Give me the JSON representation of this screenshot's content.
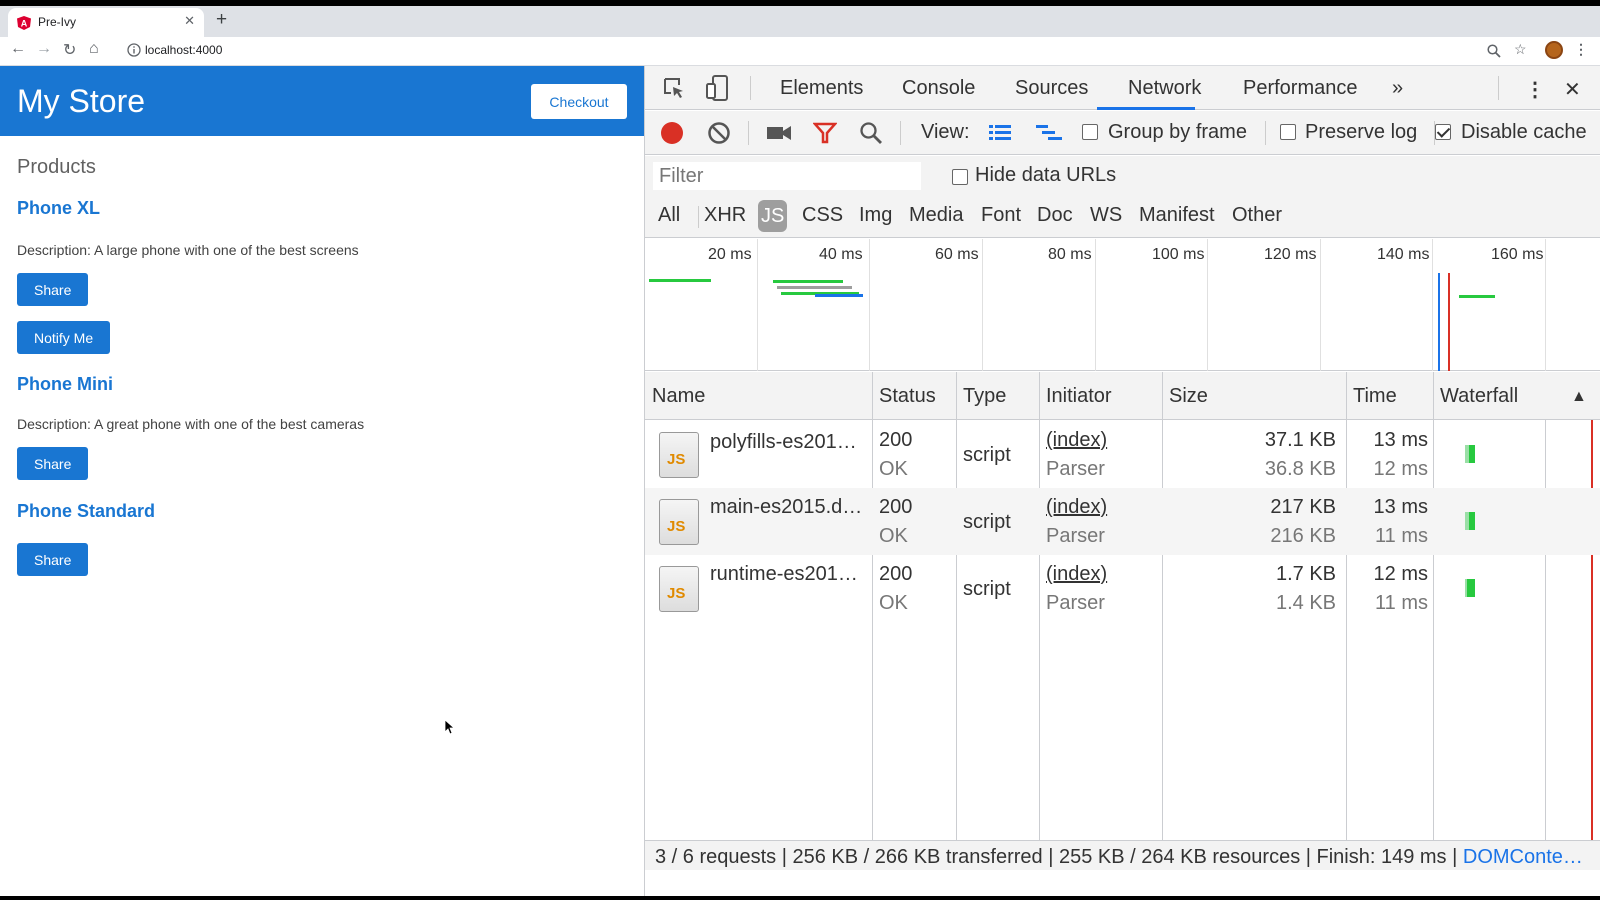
{
  "browser": {
    "tab_title": "Pre-Ivy",
    "url": "localhost:4000"
  },
  "app": {
    "title": "My Store",
    "checkout_label": "Checkout",
    "products_heading": "Products",
    "products": [
      {
        "name": "Phone XL",
        "description": "Description: A large phone with one of the best screens",
        "share_label": "Share",
        "notify_label": "Notify Me"
      },
      {
        "name": "Phone Mini",
        "description": "Description: A great phone with one of the best cameras",
        "share_label": "Share"
      },
      {
        "name": "Phone Standard",
        "share_label": "Share"
      }
    ]
  },
  "devtools": {
    "tabs": [
      "Elements",
      "Console",
      "Sources",
      "Network",
      "Performance"
    ],
    "active_tab": "Network",
    "more_tabs_glyph": "»",
    "toolbar": {
      "view_label": "View:",
      "group_by_frame_label": "Group by frame",
      "group_by_frame_checked": false,
      "preserve_log_label": "Preserve log",
      "preserve_log_checked": false,
      "disable_cache_label": "Disable cache",
      "disable_cache_checked": true
    },
    "filter": {
      "placeholder": "Filter",
      "hide_data_urls_label": "Hide data URLs",
      "hide_data_urls_checked": false,
      "types": [
        "All",
        "XHR",
        "JS",
        "CSS",
        "Img",
        "Media",
        "Font",
        "Doc",
        "WS",
        "Manifest",
        "Other"
      ],
      "selected_type": "JS"
    },
    "overview": {
      "labels": [
        "20 ms",
        "40 ms",
        "60 ms",
        "80 ms",
        "100 ms",
        "120 ms",
        "140 ms",
        "160 ms"
      ]
    },
    "columns": [
      "Name",
      "Status",
      "Type",
      "Initiator",
      "Size",
      "Time",
      "Waterfall"
    ],
    "sort_indicator": "▲",
    "rows": [
      {
        "icon": "JS",
        "name": "polyfills-es201…",
        "status": "200",
        "status_text": "OK",
        "type": "script",
        "initiator": "(index)",
        "initiator_sub": "Parser",
        "size": "37.1 KB",
        "size_sub": "36.8 KB",
        "time": "13 ms",
        "time_sub": "12 ms"
      },
      {
        "icon": "JS",
        "name": "main-es2015.d…",
        "status": "200",
        "status_text": "OK",
        "type": "script",
        "initiator": "(index)",
        "initiator_sub": "Parser",
        "size": "217 KB",
        "size_sub": "216 KB",
        "time": "13 ms",
        "time_sub": "11 ms"
      },
      {
        "icon": "JS",
        "name": "runtime-es201…",
        "status": "200",
        "status_text": "OK",
        "type": "script",
        "initiator": "(index)",
        "initiator_sub": "Parser",
        "size": "1.7 KB",
        "size_sub": "1.4 KB",
        "time": "12 ms",
        "time_sub": "11 ms"
      }
    ],
    "status_bar": {
      "summary": "3 / 6 requests | 256 KB / 266 KB transferred | 255 KB / 264 KB resources | Finish: 149 ms | ",
      "link": "DOMConte…"
    }
  },
  "colors": {
    "app_primary": "#1976d2",
    "devtools_accent": "#1a73e8",
    "record": "#d93025",
    "waterfall_green": "#27c93f"
  }
}
